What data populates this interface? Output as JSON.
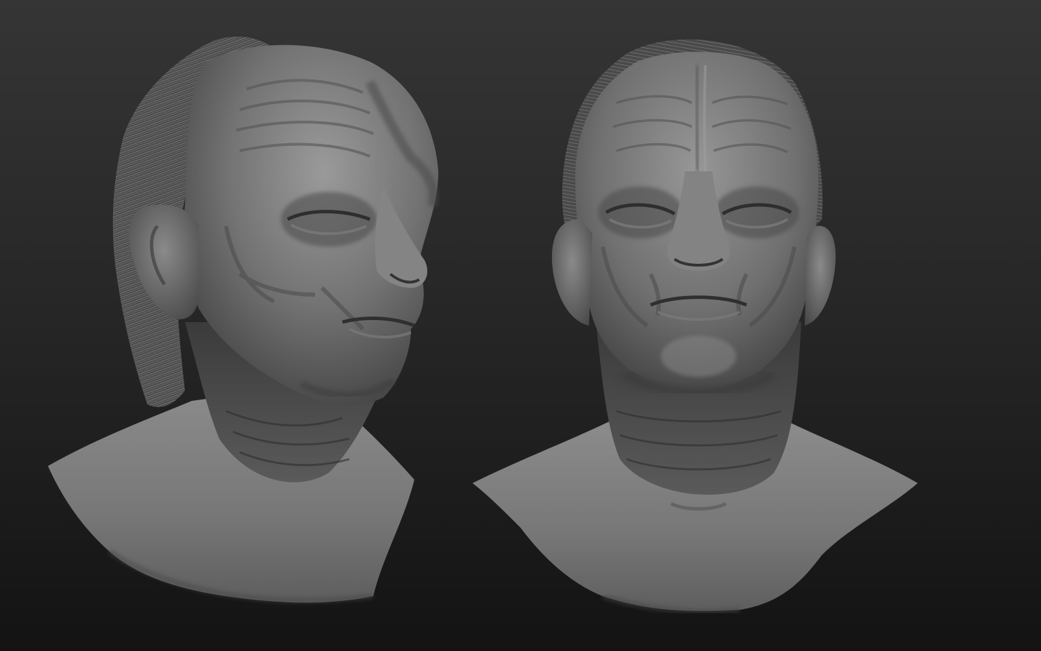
{
  "scene": {
    "subjects": [
      "sculpt-three-quarter-view",
      "sculpt-front-view"
    ],
    "material": "matte grey clay",
    "colors": {
      "background_top": "#333333",
      "background_bottom": "#141414",
      "clay_light": "#8f8f8f",
      "clay_mid": "#6b6b6b",
      "clay_dark": "#3a3a3a",
      "hair": "#777777"
    }
  }
}
